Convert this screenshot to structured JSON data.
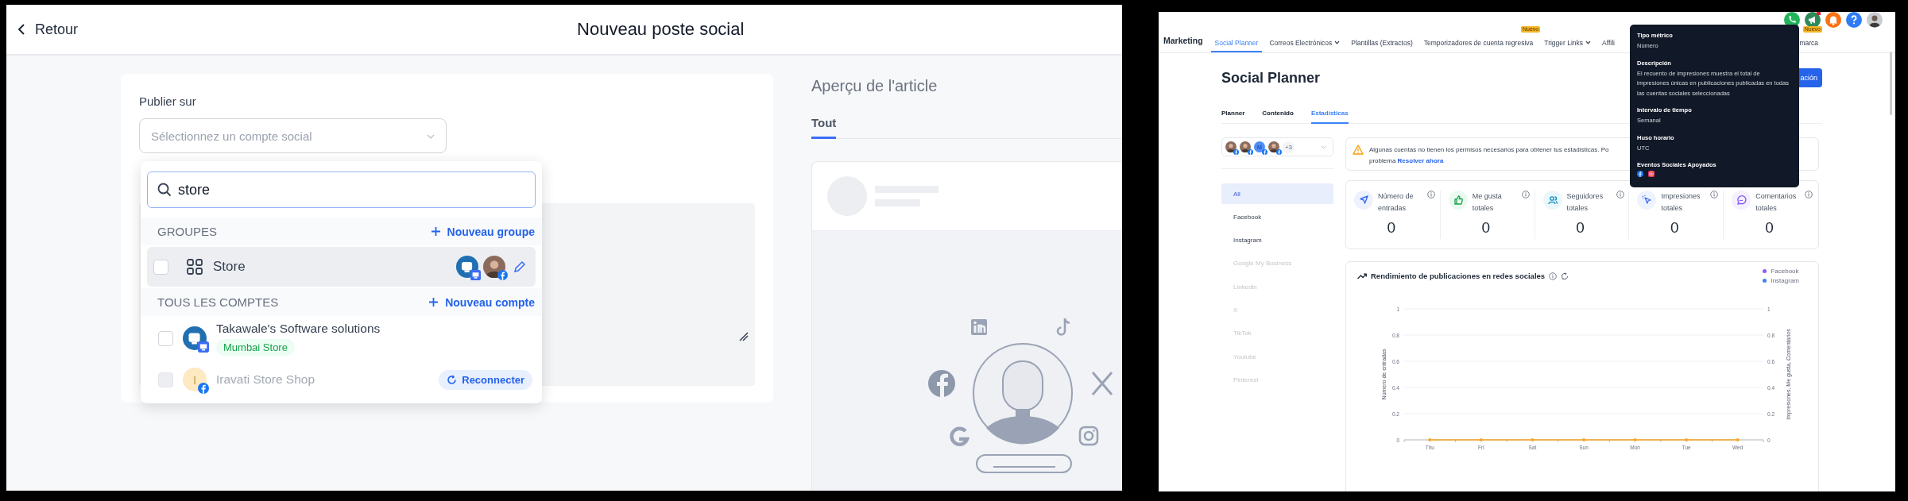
{
  "post_editor": {
    "header": {
      "back": "Retour",
      "title": "Nouveau poste social"
    },
    "form": {
      "label": "Publier sur",
      "account_select": {
        "placeholder": "Sélectionnez un compte social"
      }
    },
    "account_dropdown": {
      "search": {
        "value": "store"
      },
      "groups_section": {
        "heading": "GROUPES",
        "action": "Nouveau groupe"
      },
      "groups": [
        {
          "name": "Store",
          "checked": false,
          "highlighted": true,
          "avatars": [
            {
              "kind": "logo",
              "badge": {
                "kind": "page"
              }
            },
            {
              "kind": "photo",
              "badge": {
                "kind": "facebook"
              }
            }
          ]
        }
      ],
      "accounts_section": {
        "heading": "TOUS LES COMPTES",
        "action": "Nouveau compte"
      },
      "accounts": [
        {
          "name": "Takawale's Software solutions",
          "checked": false,
          "disabled": false,
          "avatar": {
            "kind": "logo",
            "badge": {
              "kind": "page"
            }
          },
          "tag": "Mumbai Store"
        },
        {
          "name": "Iravati Store Shop",
          "checked": false,
          "disabled": true,
          "avatar": {
            "kind": "letter",
            "letter": "I",
            "badge": {
              "kind": "facebook"
            }
          },
          "action": "Reconnecter"
        }
      ]
    },
    "preview": {
      "title": "Aperçu de l'article",
      "tabs": [
        {
          "label": "Tout",
          "selected": true
        }
      ]
    }
  },
  "social_planner": {
    "nav": {
      "section": "Marketing",
      "items": [
        {
          "label": "Social Planner",
          "selected": true,
          "menu": false
        },
        {
          "label": "Correos Electrónicos",
          "selected": false,
          "menu": true
        },
        {
          "label": "Plantillas (Extractos)",
          "selected": false,
          "menu": false
        },
        {
          "label": "Temporizadores de cuenta regresiva",
          "selected": false,
          "menu": false,
          "badge": "Nuevo"
        },
        {
          "label": "Trigger Links",
          "selected": false,
          "menu": true
        },
        {
          "label": "Affili",
          "selected": false,
          "menu": false
        }
      ],
      "right_item": {
        "label": "marca",
        "badge": "Nuevo"
      }
    },
    "page_title": "Social Planner",
    "create_button": "ación",
    "tabs": [
      {
        "label": "Planner",
        "selected": false
      },
      {
        "label": "Contenido",
        "selected": false
      },
      {
        "label": "Estadísticas",
        "selected": true
      }
    ],
    "account_filter": {
      "avatars": [
        {
          "kind": "photo"
        },
        {
          "kind": "photo"
        },
        {
          "kind": "letter",
          "letter": "M"
        },
        {
          "kind": "photo"
        }
      ],
      "more": "+3"
    },
    "platforms": [
      {
        "label": "All",
        "selected": true,
        "disabled": false
      },
      {
        "label": "Facebook",
        "selected": false,
        "disabled": false
      },
      {
        "label": "Instagram",
        "selected": false,
        "disabled": false
      },
      {
        "label": "Google My Business",
        "selected": false,
        "disabled": true
      },
      {
        "label": "Linkedin",
        "selected": false,
        "disabled": true
      },
      {
        "label": "X",
        "selected": false,
        "disabled": true
      },
      {
        "label": "TikTok",
        "selected": false,
        "disabled": true
      },
      {
        "label": "Youtube",
        "selected": false,
        "disabled": true
      },
      {
        "label": "Pinterest",
        "selected": false,
        "disabled": true
      }
    ],
    "alert": {
      "line_1": "Algunas cuentas no tienen los permisos necesarios para obtener tus estadísticas. Po",
      "line_2": "problema",
      "link": "Resolver ahora"
    },
    "stats": [
      {
        "kind": "posts",
        "label": "Número de entradas",
        "value": "0"
      },
      {
        "kind": "likes",
        "label": "Me gusta totales",
        "value": "0"
      },
      {
        "kind": "followers",
        "label": "Seguidores totales",
        "value": "0"
      },
      {
        "kind": "impressions",
        "label": "Impresiones totales",
        "value": "0"
      },
      {
        "kind": "comments",
        "label": "Comentarios totales",
        "value": "0"
      }
    ],
    "tooltip": {
      "sections": [
        {
          "kind": "text",
          "heading": "Tipo métrico",
          "text": "Número"
        },
        {
          "kind": "text",
          "heading": "Descripción",
          "text": "El recuento de impresiones muestra el total de impresiones únicas en publicaciones publicadas en todas las cuentas sociales seleccionadas"
        },
        {
          "kind": "text",
          "heading": "Intervalo de tiempo",
          "text": "Semanal"
        },
        {
          "kind": "text",
          "heading": "Huso horario",
          "text": "UTC"
        },
        {
          "kind": "platforms",
          "heading": "Eventos Sociales Apoyados"
        }
      ]
    },
    "chart": {
      "title": "Rendimiento de publicaciones en redes sociales",
      "legend": [
        {
          "label": "Facebook",
          "color": "#8b5cf6"
        },
        {
          "label": "Instagram",
          "color": "#3b82f6"
        }
      ],
      "right_axis": {
        "label": "Impresiones, Me gusta, Comentarios",
        "ticks": [
          "1",
          "0.8",
          "0.6",
          "0.4",
          "0.2",
          "0"
        ]
      },
      "chart_data": {
        "type": "line",
        "ylabel": "Número de entradas",
        "categories": [
          "Thu",
          "Fri",
          "Sat",
          "Sun",
          "Mon",
          "Tue",
          "Wed"
        ],
        "series": [
          {
            "color": "#f5a623",
            "values": [
              0,
              0,
              0,
              0,
              0,
              0,
              0
            ]
          }
        ],
        "grid": true,
        "ylim": [
          0,
          1
        ],
        "yticks": [
          {
            "value": 0,
            "label": "0"
          },
          {
            "value": 0.2,
            "label": "0.2"
          },
          {
            "value": 0.4,
            "label": "0.4"
          },
          {
            "value": 0.6,
            "label": "0.6"
          },
          {
            "value": 0.8,
            "label": "0.8"
          },
          {
            "value": 1,
            "label": "1"
          }
        ]
      }
    }
  }
}
